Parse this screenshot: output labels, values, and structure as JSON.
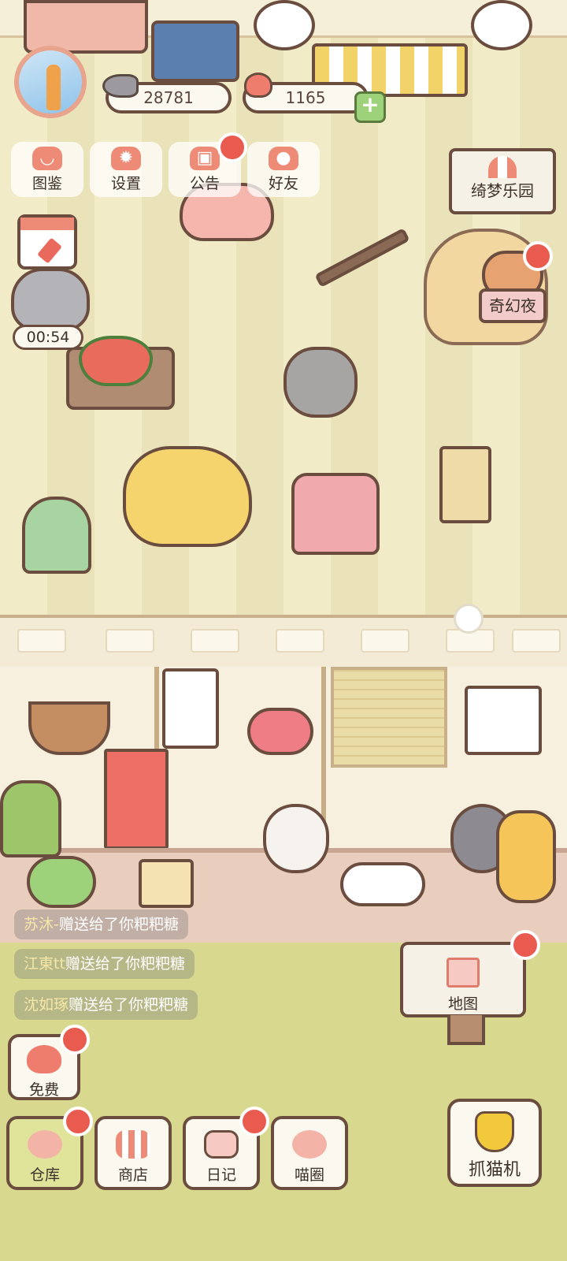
{
  "currency": {
    "fish_amount": "28781",
    "hearts_amount": "1165"
  },
  "top_menu": [
    {
      "label": "图鉴",
      "icon": "cat-head-icon"
    },
    {
      "label": "设置",
      "icon": "gear-icon"
    },
    {
      "label": "公告",
      "icon": "gift-icon"
    },
    {
      "label": "好友",
      "icon": "friends-icon"
    }
  ],
  "dream_park": {
    "label": "绮梦乐园",
    "icon": "circus-tent-icon"
  },
  "event": {
    "label": "奇幻夜"
  },
  "timer": "00:54",
  "chat": [
    {
      "name": "苏沐-",
      "text": "赠送给了你粑粑糖"
    },
    {
      "name": "江東tt",
      "text": "赠送给了你粑粑糖"
    },
    {
      "name": "沈如琢",
      "text": "赠送给了你粑粑糖"
    }
  ],
  "map_button": {
    "label": "地图",
    "icon": "house-icon"
  },
  "free_button": {
    "label": "免费",
    "icon": "heart-icon"
  },
  "bottom_nav": [
    {
      "label": "仓库",
      "icon": "storage-icon"
    },
    {
      "label": "商店",
      "icon": "shop-icon"
    },
    {
      "label": "日记",
      "icon": "diary-icon"
    },
    {
      "label": "喵圈",
      "icon": "planet-cat-icon"
    }
  ],
  "claw_machine": {
    "label": "抓猫机",
    "icon": "claw-icon"
  },
  "colors": {
    "accent": "#ee8b76",
    "badge": "#e95a4f",
    "outline": "#6b4d3f",
    "grass": "#d8d98f"
  }
}
